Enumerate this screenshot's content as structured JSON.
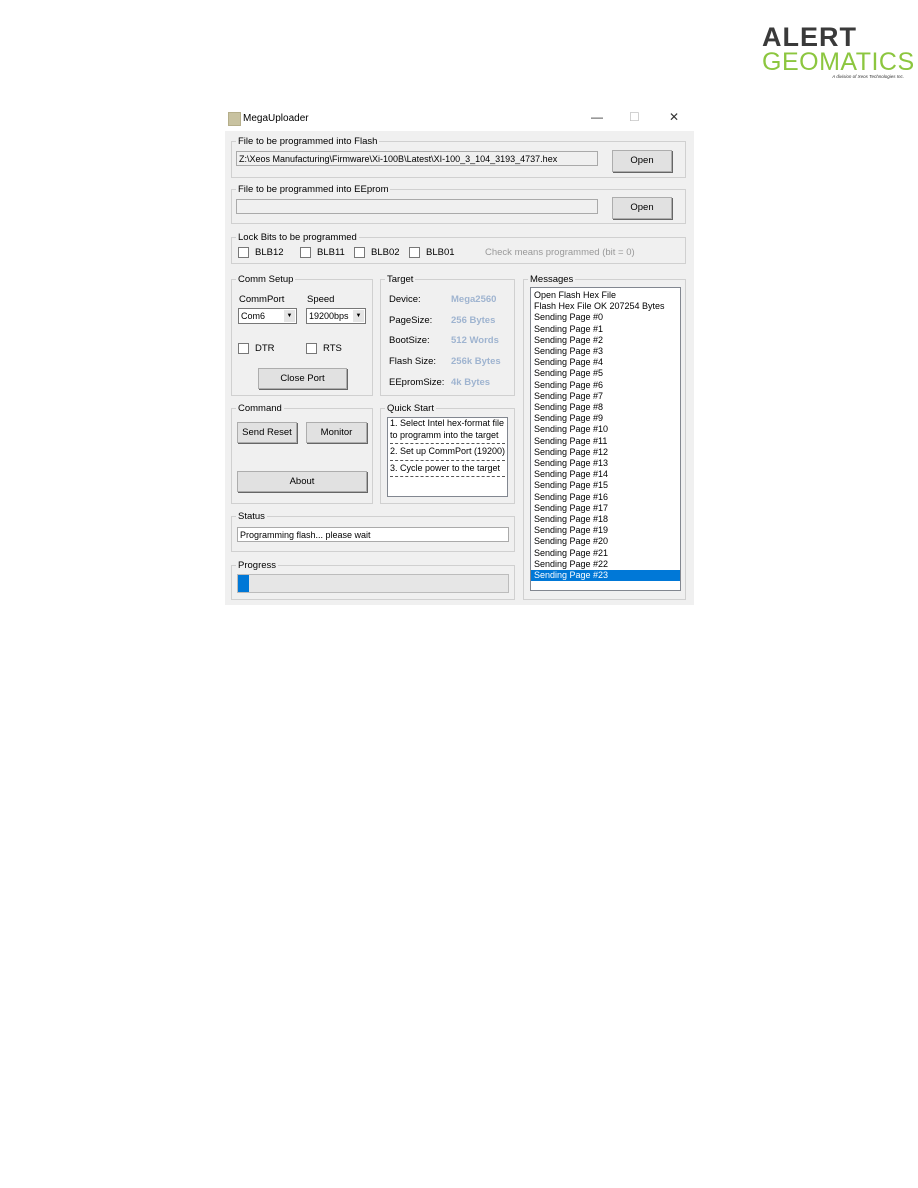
{
  "logo": {
    "line1": "ALERT",
    "line2": "GEOMATICS",
    "tagline": "A division of Xeos Technologies Inc.",
    "brand_color": "#8cc63f"
  },
  "window": {
    "title": "MegaUploader",
    "minimize": "—",
    "maximize": "☐",
    "close": "✕"
  },
  "flash": {
    "legend": "File to be programmed into Flash",
    "path": "Z:\\Xeos Manufacturing\\Firmware\\Xi-100B\\Latest\\XI-100_3_104_3193_4737.hex",
    "open": "Open"
  },
  "eeprom": {
    "legend": "File to be programmed into EEprom",
    "path": "",
    "open": "Open"
  },
  "lockbits": {
    "legend": "Lock Bits to be programmed",
    "bits": [
      "BLB12",
      "BLB11",
      "BLB02",
      "BLB01"
    ],
    "note": "Check means programmed (bit = 0)"
  },
  "comm": {
    "legend": "Comm Setup",
    "port_label": "CommPort",
    "port": "Com6",
    "speed_label": "Speed",
    "speed": "19200bps",
    "dtr": "DTR",
    "rts": "RTS",
    "close_port": "Close Port"
  },
  "target": {
    "legend": "Target",
    "rows": [
      {
        "label": "Device:",
        "value": "Mega2560"
      },
      {
        "label": "PageSize:",
        "value": "256 Bytes"
      },
      {
        "label": "BootSize:",
        "value": "512 Words"
      },
      {
        "label": "Flash Size:",
        "value": "256k Bytes"
      },
      {
        "label": "EEpromSize:",
        "value": "4k Bytes"
      }
    ]
  },
  "command": {
    "legend": "Command",
    "send_reset": "Send Reset",
    "monitor": "Monitor",
    "about": "About"
  },
  "quickstart": {
    "legend": "Quick Start",
    "step1a": "1. Select Intel hex-format file",
    "step1b": "to programm  into  the target",
    "step2": "2. Set up CommPort (19200)",
    "step3": "3. Cycle power to the target"
  },
  "status": {
    "legend": "Status",
    "text": "Programming flash... please wait"
  },
  "progress": {
    "legend": "Progress",
    "percent": 4,
    "color": "#0078d7"
  },
  "messages": {
    "legend": "Messages",
    "items": [
      "Open Flash Hex File",
      "Flash Hex File OK 207254 Bytes",
      "Sending Page #0",
      "Sending Page #1",
      "Sending Page #2",
      "Sending Page #3",
      "Sending Page #4",
      "Sending Page #5",
      "Sending Page #6",
      "Sending Page #7",
      "Sending Page #8",
      "Sending Page #9",
      "Sending Page #10",
      "Sending Page #11",
      "Sending Page #12",
      "Sending Page #13",
      "Sending Page #14",
      "Sending Page #15",
      "Sending Page #16",
      "Sending Page #17",
      "Sending Page #18",
      "Sending Page #19",
      "Sending Page #20",
      "Sending Page #21",
      "Sending Page #22",
      "Sending Page #23"
    ],
    "selected": 25
  }
}
